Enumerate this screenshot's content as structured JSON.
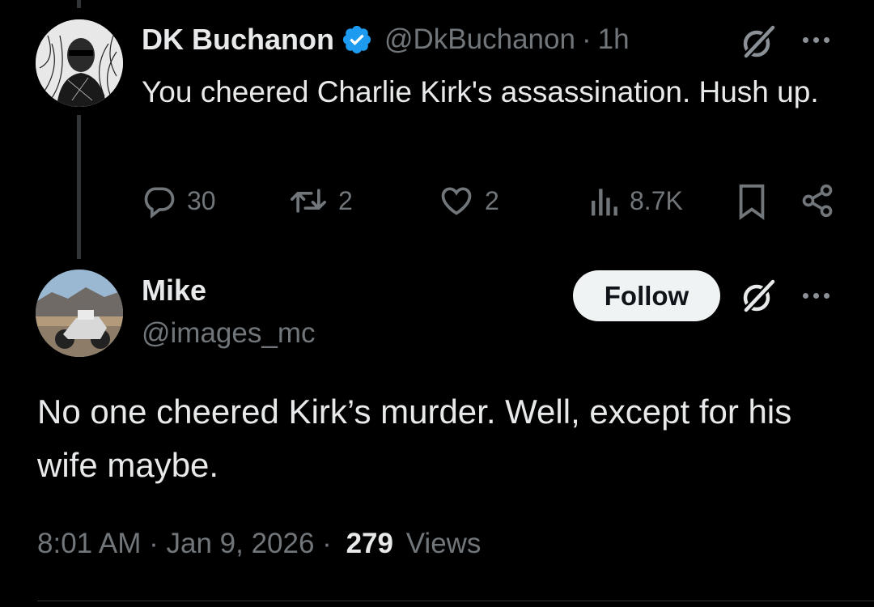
{
  "parent_tweet": {
    "display_name": "DK Buchanon",
    "handle": "@DkBuchanon",
    "separator": "·",
    "time": "1h",
    "text": "You cheered Charlie Kirk's assassination. Hush up.",
    "replies": "30",
    "reposts": "2",
    "likes": "2",
    "views": "8.7K"
  },
  "reply_tweet": {
    "display_name": "Mike",
    "handle": "@images_mc",
    "follow_label": "Follow",
    "text": "No one cheered Kirk’s murder. Well, except for his wife maybe.",
    "timestamp": "8:01 AM · Jan 9, 2026 ·",
    "views_count": "279",
    "views_label": "Views"
  },
  "colors": {
    "background": "#000000",
    "text": "#e7e9ea",
    "secondary": "#71767b",
    "verified": "#1d9bf0",
    "follow_button": "#eff3f4"
  }
}
